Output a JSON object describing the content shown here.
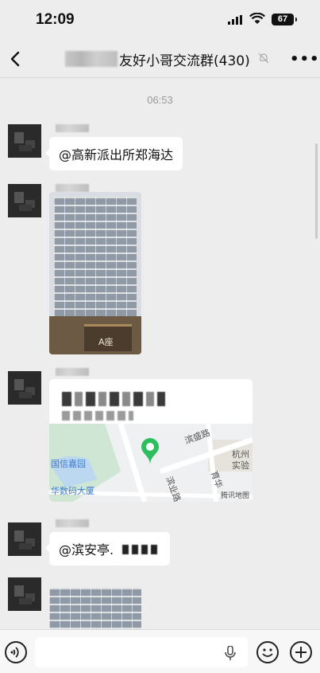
{
  "status": {
    "time": "12:09",
    "battery": "67"
  },
  "header": {
    "title": "友好小哥交流群(430)",
    "icons": [
      "back-arrow-icon",
      "mute-bell-icon",
      "more-icon"
    ]
  },
  "chat": {
    "timestamp": "06:53",
    "messages": [
      {
        "type": "text",
        "text": "@高新派出所郑海达"
      },
      {
        "type": "image",
        "caption": "A座"
      },
      {
        "type": "location",
        "map_labels": [
          "滨盛路",
          "杭州",
          "实验",
          "国信嘉园",
          "华数码大厦",
          "滨业路",
          "育华"
        ],
        "map_provider": "腾讯地图"
      },
      {
        "type": "text",
        "text": "@滨安亭."
      },
      {
        "type": "image"
      }
    ]
  },
  "input_bar": {
    "icons": [
      "voice-icon",
      "microphone-icon",
      "emoji-icon",
      "plus-icon"
    ]
  },
  "colors": {
    "background": "#ededed",
    "bubble": "#ffffff",
    "map_pin": "#2dbe60"
  }
}
